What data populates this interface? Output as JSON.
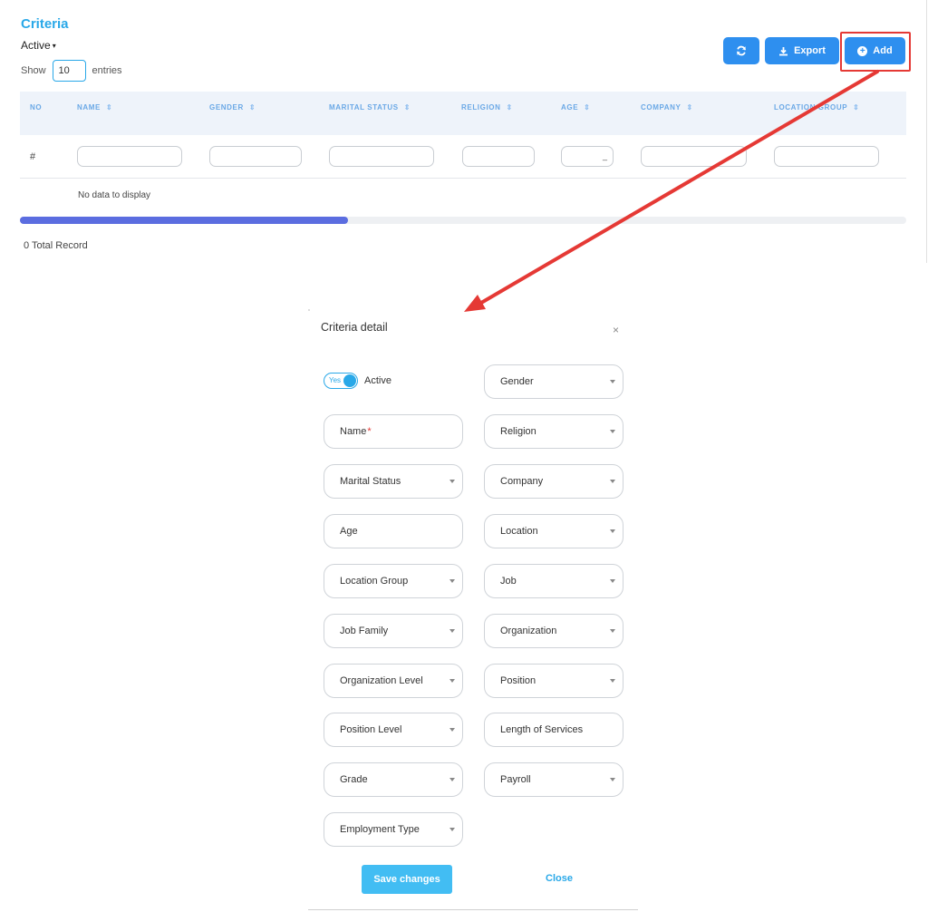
{
  "page": {
    "title": "Criteria"
  },
  "filter": {
    "status_label": "Active"
  },
  "entries": {
    "show_label": "Show",
    "value": "10",
    "entries_label": "entries"
  },
  "toolbar": {
    "refresh_icon": "refresh-icon",
    "export_label": "Export",
    "export_icon": "download-icon",
    "add_label": "Add",
    "add_icon": "plus-circle-icon"
  },
  "table": {
    "columns": [
      "NO",
      "NAME",
      "GENDER",
      "MARITAL STATUS",
      "RELIGION",
      "AGE",
      "COMPANY",
      "LOCATION GROUP"
    ],
    "filter_row_label": "#",
    "age_filter_placeholder": "_",
    "empty_message": "No data to display",
    "scroll_fraction": 0.37
  },
  "footer": {
    "total_label": "0 Total Record"
  },
  "modal": {
    "title": "Criteria detail",
    "close_glyph": "×",
    "active_toggle": {
      "on_text": "Yes",
      "label": "Active",
      "checked": true
    },
    "fields_left": [
      {
        "label": "Name",
        "required": "*",
        "type": "text"
      },
      {
        "label": "Marital Status",
        "type": "select"
      },
      {
        "label": "Age",
        "type": "text"
      },
      {
        "label": "Location Group",
        "type": "select"
      },
      {
        "label": "Job Family",
        "type": "select"
      },
      {
        "label": "Organization Level",
        "type": "select"
      },
      {
        "label": "Position Level",
        "type": "select"
      },
      {
        "label": "Grade",
        "type": "select"
      },
      {
        "label": "Employment Type",
        "type": "select"
      }
    ],
    "fields_right": [
      {
        "label": "Gender",
        "type": "select"
      },
      {
        "label": "Religion",
        "type": "select"
      },
      {
        "label": "Company",
        "type": "select"
      },
      {
        "label": "Location",
        "type": "select"
      },
      {
        "label": "Job",
        "type": "select"
      },
      {
        "label": "Organization",
        "type": "select"
      },
      {
        "label": "Position",
        "type": "select"
      },
      {
        "label": "Length of Services",
        "type": "text"
      },
      {
        "label": "Payroll",
        "type": "select"
      }
    ],
    "save_label": "Save changes",
    "close_label": "Close"
  },
  "colors": {
    "accent": "#29a8e8",
    "button_blue": "#2e8fef",
    "highlight_red": "#e53935",
    "scroll_thumb": "#5b6de0"
  }
}
